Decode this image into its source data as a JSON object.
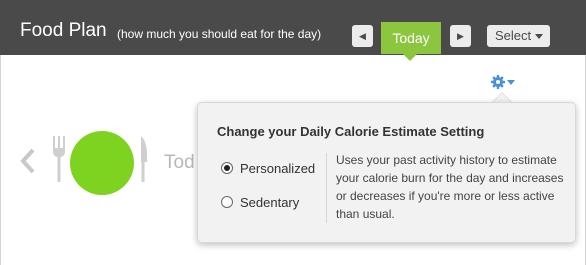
{
  "header": {
    "title": "Food Plan",
    "subtitle": "(how much you should eat for the day)",
    "prev_icon": "left-triangle",
    "next_icon": "right-triangle",
    "today_label": "Today",
    "select_label": "Select",
    "background_color": "#4a4a4a",
    "accent_color": "#8cc63f"
  },
  "settings_button": {
    "icon": "gear-with-dropdown",
    "color": "#4a90d9"
  },
  "plate_section": {
    "prev_icon": "chevron-left",
    "fork_icon": "fork",
    "plate_color": "#7ed321",
    "knife_icon": "knife",
    "day_label_partial": "Tod"
  },
  "popup": {
    "title": "Change your Daily Calorie Estimate Setting",
    "options": [
      {
        "label": "Personalized",
        "selected": true
      },
      {
        "label": "Sedentary",
        "selected": false
      }
    ],
    "description": "Uses your past activity history to estimate your calorie burn for the day and increases or decreases if you're more or less active than usual."
  }
}
